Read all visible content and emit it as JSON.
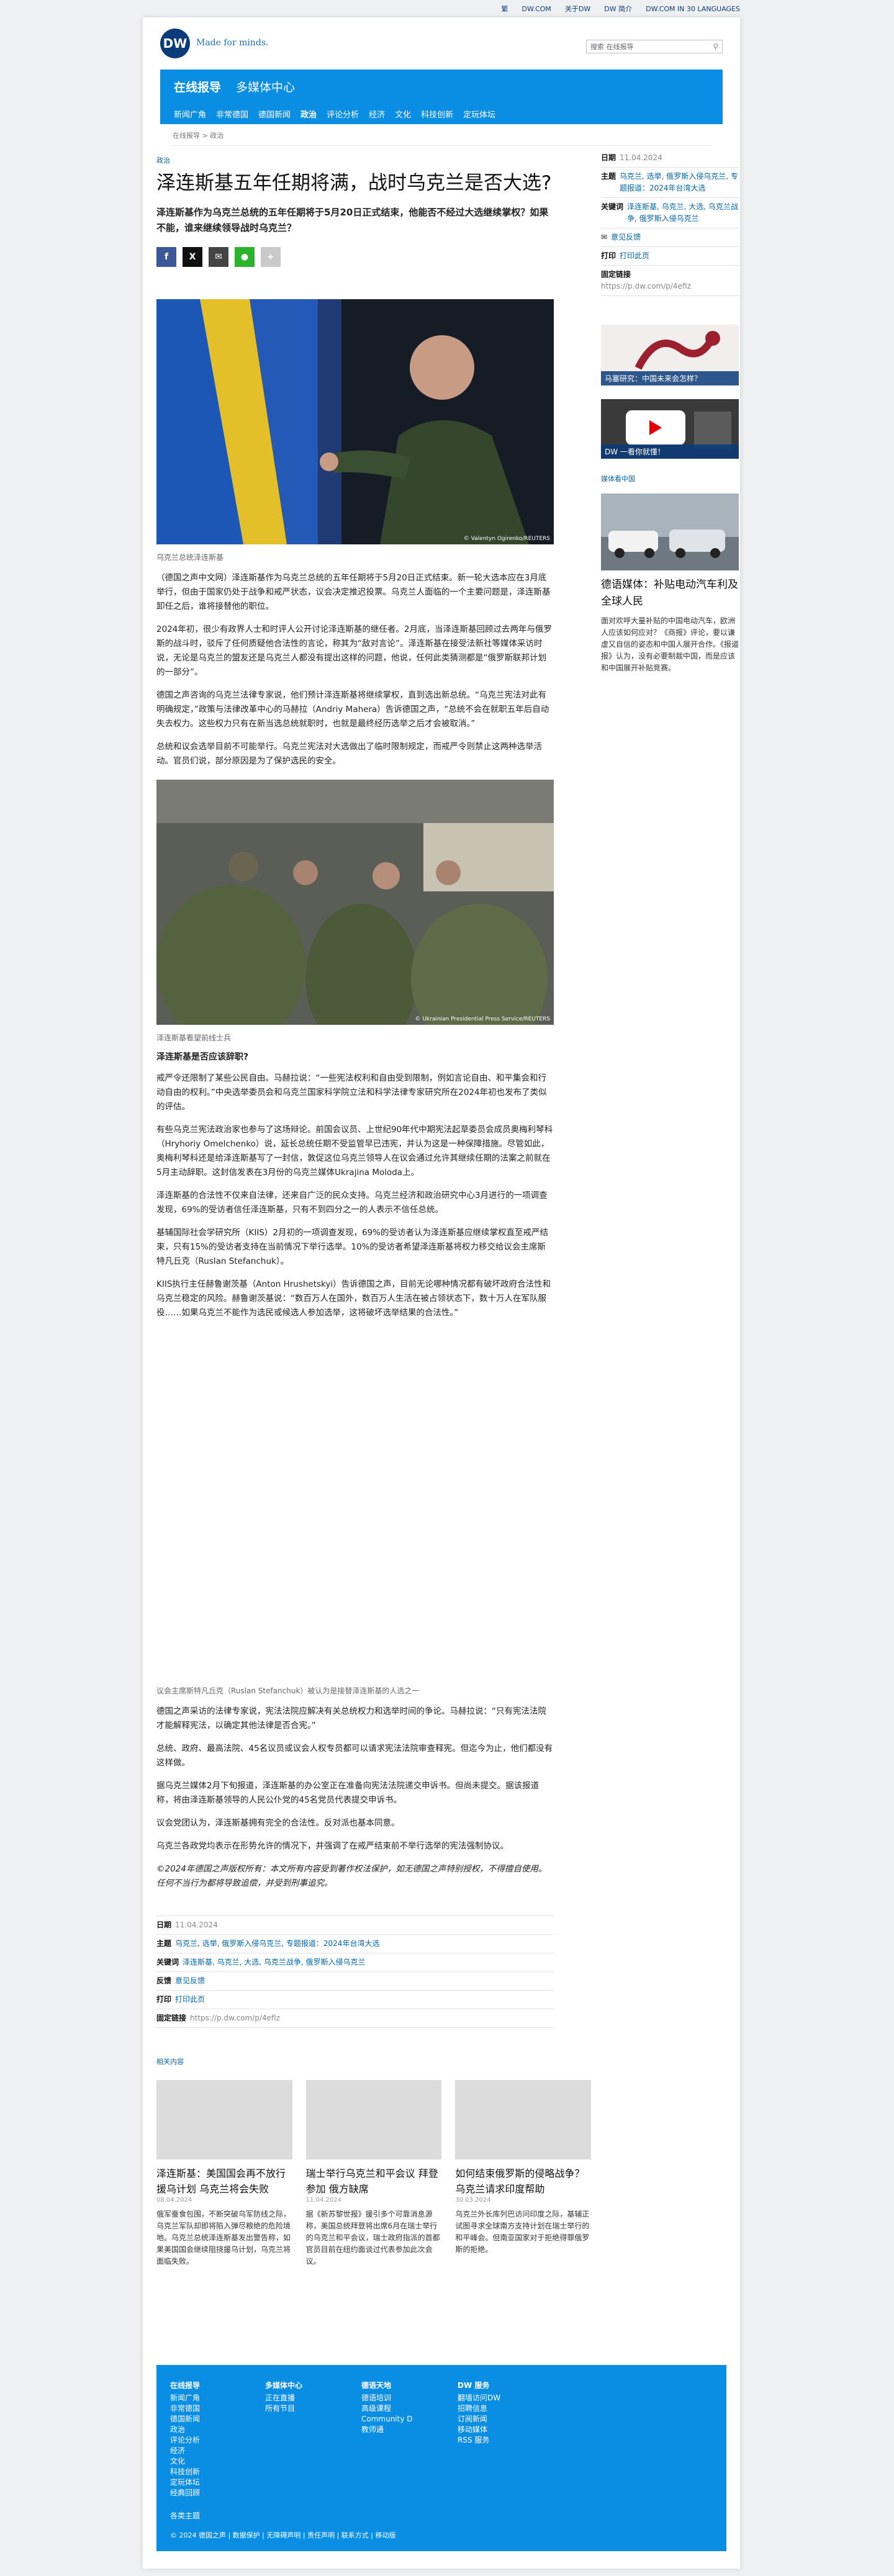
{
  "topbar": {
    "links": [
      "繁",
      "DW.COM",
      "关于DW",
      "DW 简介",
      "DW.COM IN 30 LANGUAGES"
    ]
  },
  "brand": {
    "logo": "DW",
    "tagline": "Made for minds.",
    "search_placeholder": "搜索 在线报导"
  },
  "nav": {
    "primary": "在线报导",
    "secondary": "多媒体中心",
    "items": [
      "新闻广角",
      "非常德国",
      "德国新闻",
      "政治",
      "评论分析",
      "经济",
      "文化",
      "科技创新",
      "定玩体坛"
    ]
  },
  "breadcrumb": "在线报导 > 政治",
  "article": {
    "kicker": "政治",
    "title": "泽连斯基五年任期将满，战时乌克兰是否大选?",
    "lead": "泽连斯基作为乌克兰总统的五年任期将于5月20日正式结束，他能否不经过大选继续掌权？如果不能，谁来继续领导战时乌克兰？",
    "share_icons": [
      "facebook-icon",
      "x-icon",
      "email-icon",
      "line-icon",
      "more-icon"
    ],
    "image1": {
      "credit": "© Valentyn Ogirenko/REUTERS",
      "caption": "乌克兰总统泽连斯基"
    },
    "paragraphs1": [
      "（德国之声中文网）泽连斯基作为乌克兰总统的五年任期将于5月20日正式结束。新一轮大选本应在3月底举行，但由于国家仍处于战争和戒严状态，议会决定推迟投票。乌克兰人面临的一个主要问题是，泽连斯基卸任之后，谁将接替他的职位。",
      "2024年初，很少有政界人士和时评人公开讨论泽连斯基的继任者。2月底，当泽连斯基回顾过去两年与俄罗斯的战斗时，驳斥了任何质疑他合法性的言论，称其为“敌对言论”。泽连斯基在接受法新社等媒体采访时说，无论是乌克兰的盟友还是乌克兰人都没有提出这样的问题，他说，任何此类猜测都是“俄罗斯联邦计划的一部分”。",
      "德国之声咨询的乌克兰法律专家说，他们预计泽连斯基将继续掌权，直到选出新总统。“乌克兰宪法对此有明确规定，”政策与法律改革中心的马赫拉（Andriy Mahera）告诉德国之声，“总统不会在就职五年后自动失去权力。这些权力只有在新当选总统就职时，也就是最终经历选举之后才会被取消。”",
      "总统和议会选举目前不可能举行。乌克兰宪法对大选做出了临时限制规定，而戒严令则禁止这两种选举活动。官员们说，部分原因是为了保护选民的安全。"
    ],
    "image2": {
      "credit": "© Ukrainian Presidential Press Service/REUTERS",
      "caption": "泽连斯基看望前线士兵"
    },
    "subhead1": "泽连斯基是否应该辞职?",
    "paragraphs2": [
      "戒严令还限制了某些公民自由。马赫拉说：“一些宪法权利和自由受到限制，例如言论自由、和平集会和行动自由的权利。”中央选举委员会和乌克兰国家科学院立法和科学法律专家研究所在2024年初也发布了类似的评估。",
      "有些乌克兰宪法政治家也参与了这场辩论。前国会议员、上世纪90年代中期宪法起草委员会成员奥梅利琴科（Hryhoriy Omelchenko）说，延长总统任期不受监管早已违宪，并认为这是一种保障措施。尽管如此，奥梅利琴科还是给泽连斯基写了一封信，敦促这位乌克兰领导人在议会通过允许其继续任期的法案之前就在5月主动辞职。这封信发表在3月份的乌克兰媒体Ukrajina Moloda上。",
      "泽连斯基的合法性不仅来自法律，还来自广泛的民众支持。乌克兰经济和政治研究中心3月进行的一项调查发现，69%的受访者信任泽连斯基，只有不到四分之一的人表示不信任总统。",
      "基辅国际社会学研究所（KIIS）2月初的一项调查发现，69%的受访者认为泽连斯基应继续掌权直至戒严结束，只有15%的受访者支持在当前情况下举行选举。10%的受访者希望泽连斯基将权力移交给议会主席斯特凡丘克（Ruslan Stefanchuk）。",
      "KIIS执行主任赫鲁谢茨基（Anton Hrushetskyi）告诉德国之声，目前无论哪种情况都有破坏政府合法性和乌克兰稳定的风险。赫鲁谢茨基说：“数百万人在国外，数百万人生活在被占领状态下，数十万人在军队服役……如果乌克兰不能作为选民或候选人参加选举，这将破坏选举结果的合法性。”"
    ],
    "image3_caption": "议会主席斯特凡丘克（Ruslan Stefanchuk）被认为是接替泽连斯基的人选之一",
    "paragraphs3": [
      "德国之声采访的法律专家说，宪法法院应解决有关总统权力和选举时间的争论。马赫拉说：“只有宪法法院才能解释宪法，以确定其他法律是否合宪。”",
      "总统、政府、最高法院、45名议员或议会人权专员都可以请求宪法法院审查释宪。但迄今为止，他们都没有这样做。",
      "据乌克兰媒体2月下旬报道，泽连斯基的办公室正在准备向宪法法院递交申诉书。但尚未提交。据该报道称，将由泽连斯基领导的人民公仆党的45名党员代表提交申诉书。",
      "议会党团认为，泽连斯基拥有完全的合法性。反对派也基本同意。",
      "乌克兰各政党均表示在形势允许的情况下，并强调了在戒严结束前不举行选举的宪法强制协议。"
    ],
    "copyright": "©2024年德国之声版权所有：本文所有内容受到著作权法保护，如无德国之声特别授权，不得擅自使用。任何不当行为都将导致追偿，并受到刑事追究。"
  },
  "meta": {
    "date_label": "日期",
    "date": "11.04.2024",
    "topics_label": "主题",
    "topics": "乌克兰, 选举, 俄罗斯入侵乌克兰, 专题报道：2024年台湾大选",
    "keywords_label": "关键词",
    "keywords": "泽连斯基, 乌克兰, 大选, 乌克兰战争, 俄罗斯入侵乌克兰",
    "feedback_label": "反馈",
    "feedback": "意见反馈",
    "print_label": "打印",
    "print": "打印此页",
    "permalink_label": "固定链接",
    "permalink": "https://p.dw.com/p/4efIz"
  },
  "sidebar": {
    "date_label": "日期",
    "date": "11.04.2024",
    "topics_label": "主题",
    "topics": "乌克兰, 选举, 俄罗斯入侵乌克兰, 专题报道：2024年台湾大选",
    "keywords_label": "关键词",
    "keywords": "泽连斯基, 乌克兰, 大选, 乌克兰战争, 俄罗斯入侵乌克兰",
    "feedback": "意见反馈",
    "print_label": "打印",
    "print": "打印此页",
    "permalink_label": "固定链接",
    "permalink": "https://p.dw.com/p/4efIz",
    "teaser1": "马塞研究：中国未来会怎样？",
    "teaser2": "DW 一看你就懂！",
    "media_label": "媒体看中国",
    "news_title": "德语媒体：补贴电动汽车利及全球人民",
    "news_text": "面对欢呼大量补贴的中国电动汽车，欧洲人应该如何应对？《商报》评论，要以谦虚又自信的姿态和中国人展开合作。《报道报》认为，没有必要制裁中国，而是应该和中国展开补贴竞赛。"
  },
  "related": {
    "label": "相关内容",
    "items": [
      {
        "title": "泽连斯基：美国国会再不放行援乌计划 乌克兰将会失败",
        "date": "08.04.2024",
        "text": "俄军蚕食包围，不断突破乌军防线之际，乌克兰军队却即将陷入弹尽粮绝的危险境地。乌克兰总统泽连斯基发出警告称，如果美国国会继续阻挠援乌计划，乌克兰将面临失败。"
      },
      {
        "title": "瑞士举行乌克兰和平会议 拜登参加 俄方缺席",
        "date": "11.04.2024",
        "text": "据《新苏黎世报》援引多个可靠消息源称，美国总统拜登将出席6月在瑞士举行的乌克兰和平会议，瑞士政府指派的首都官员目前在纽约面谈过代表参加此次会议。"
      },
      {
        "title": "如何结束俄罗斯的侵略战争？乌克兰请求印度帮助",
        "date": "30.03.2024",
        "text": "乌克兰外长库列巴访问印度之际，基辅正试图寻求全球南方支持计划在瑞士举行的和平峰会。但南亚国家对于拒绝得罪俄罗斯的拒绝。"
      }
    ]
  },
  "footer": {
    "cols": [
      {
        "title": "在线报导",
        "items": [
          "新闻广角",
          "非常德国",
          "德国新闻",
          "政治",
          "评论分析",
          "经济",
          "文化",
          "科技创新",
          "定玩体坛",
          "经典回顾"
        ]
      },
      {
        "title": "多媒体中心",
        "items": [
          "正在直播",
          "所有节目"
        ]
      },
      {
        "title": "德语天地",
        "items": [
          "德语培训",
          "高级课程",
          "Community D",
          "教师通"
        ]
      },
      {
        "title": "DW 服务",
        "items": [
          "翻墙访问DW",
          "招聘信息",
          "订阅新闻",
          "移动媒体",
          "RSS 服务"
        ]
      }
    ],
    "themes": "各类主题",
    "bottom": "© 2024 德国之声 | 数据保护 | 无障碍声明 | 责任声明 | 联系方式 | 移动版"
  }
}
